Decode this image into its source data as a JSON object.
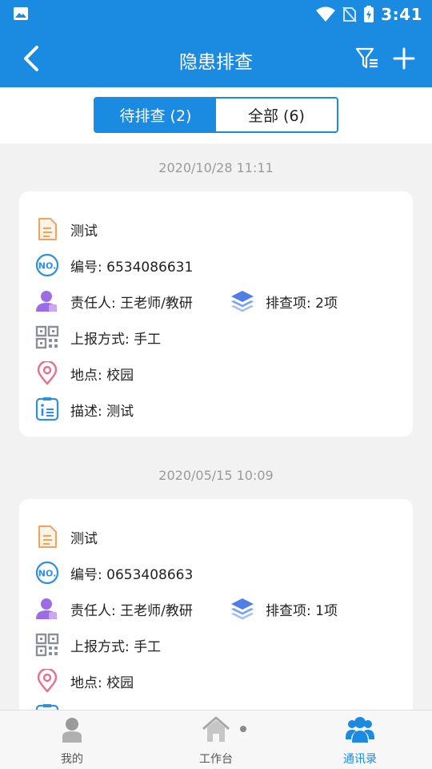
{
  "status_bar": {
    "time": "3:41"
  },
  "nav": {
    "title": "隐患排查"
  },
  "segments": [
    {
      "label": "待排查 (2)",
      "active": true
    },
    {
      "label": "全部 (6)",
      "active": false
    }
  ],
  "records": [
    {
      "date": "2020/10/28 11:11",
      "title": "测试",
      "number": "编号: 6534086631",
      "person": "责任人: 王老师/教研",
      "items": "排查项: 2项",
      "report": "上报方式: 手工",
      "location": "地点: 校园",
      "description": "描述: 测试"
    },
    {
      "date": "2020/05/15 10:09",
      "title": "测试",
      "number": "编号: 0653408663",
      "person": "责任人: 王老师/教研",
      "items": "排查项: 1项",
      "report": "上报方式: 手工",
      "location": "地点: 校园"
    }
  ],
  "tabs": [
    {
      "label": "我的",
      "icon": "person-icon"
    },
    {
      "label": "工作台",
      "icon": "home-icon"
    },
    {
      "label": "通讯录",
      "icon": "contacts-icon",
      "active": true
    }
  ],
  "colors": {
    "primary": "#1a8be0",
    "background": "#f2f2f2"
  }
}
